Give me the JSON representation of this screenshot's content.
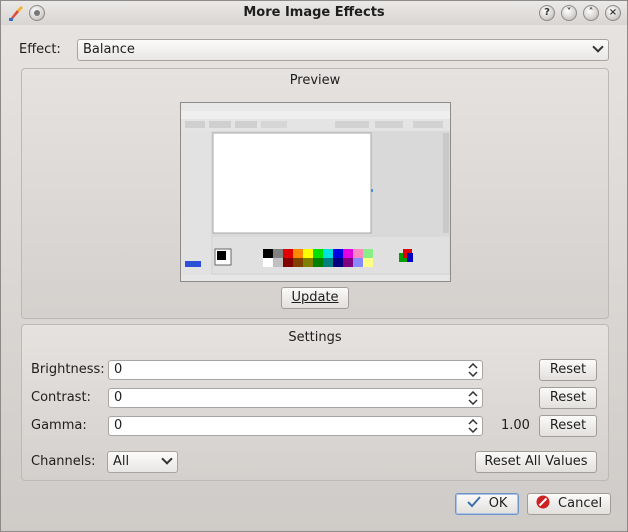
{
  "window": {
    "title": "More Image Effects"
  },
  "effect": {
    "label": "Effect:",
    "value": "Balance"
  },
  "preview": {
    "title": "Preview",
    "update_label": "Update"
  },
  "settings": {
    "title": "Settings",
    "brightness": {
      "label": "Brightness:",
      "value": "0",
      "reset": "Reset"
    },
    "contrast": {
      "label": "Contrast:",
      "value": "0",
      "reset": "Reset"
    },
    "gamma": {
      "label": "Gamma:",
      "value": "0",
      "display": "1.00",
      "reset": "Reset"
    },
    "channels": {
      "label": "Channels:",
      "value": "All"
    },
    "reset_all": "Reset All Values"
  },
  "footer": {
    "ok": "OK",
    "cancel": "Cancel"
  },
  "colors": {
    "ok_accent": "#6f94c8",
    "cancel_icon": "#cc2222"
  }
}
